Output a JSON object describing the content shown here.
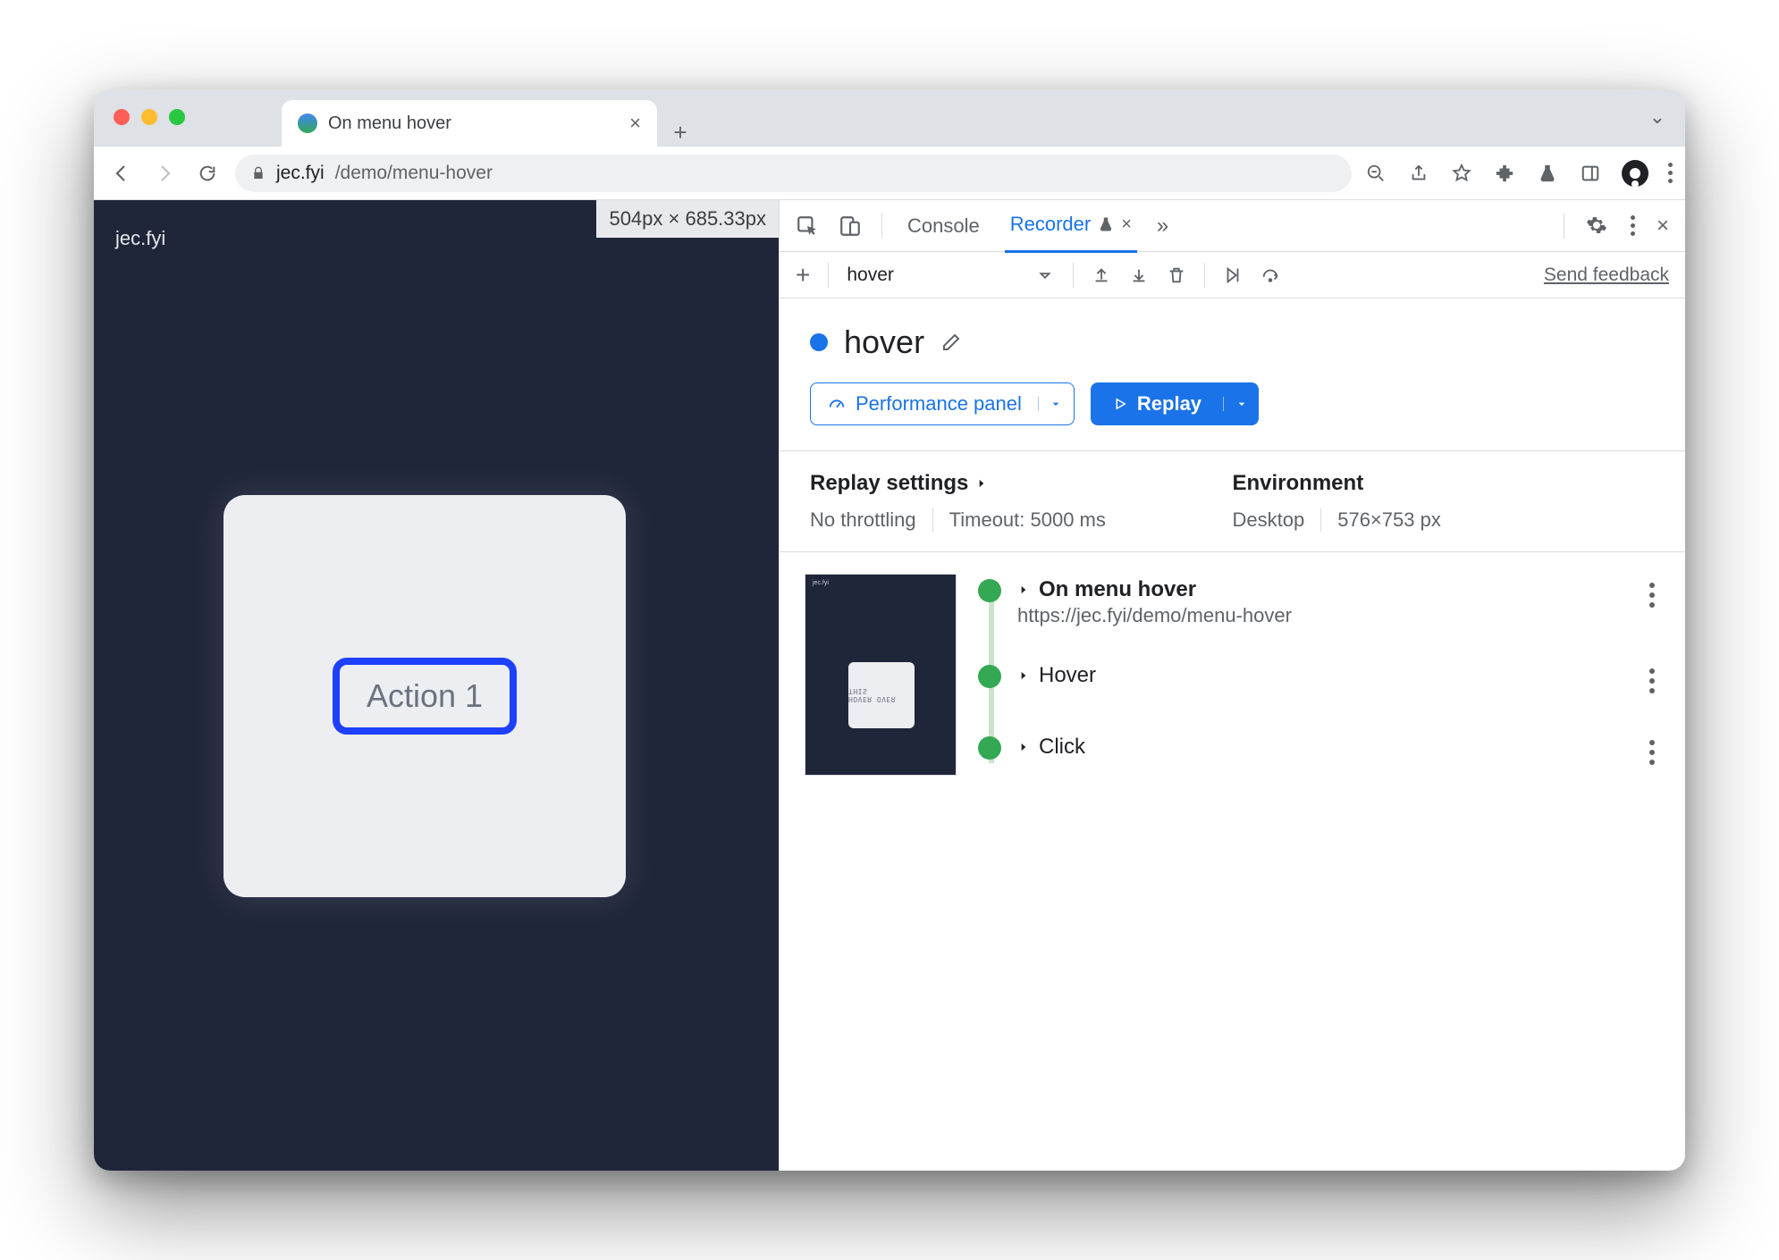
{
  "tab": {
    "title": "On menu hover"
  },
  "address": {
    "host": "jec.fyi",
    "path": "/demo/menu-hover"
  },
  "page": {
    "brand": "jec.fyi",
    "dimensions": "504px × 685.33px",
    "action_label": "Action 1"
  },
  "devtools": {
    "tabs": {
      "console": "Console",
      "recorder": "Recorder"
    },
    "toolbar": {
      "recording_select": "hover",
      "feedback": "Send feedback"
    },
    "recording": {
      "title": "hover",
      "perf_button": "Performance panel",
      "replay_button": "Replay"
    },
    "settings": {
      "replay_header": "Replay settings",
      "env_header": "Environment",
      "throttling": "No throttling",
      "timeout": "Timeout: 5000 ms",
      "device": "Desktop",
      "viewport": "576×753 px"
    },
    "steps": [
      {
        "title": "On menu hover",
        "sub": "https://jec.fyi/demo/menu-hover"
      },
      {
        "title": "Hover"
      },
      {
        "title": "Click"
      }
    ]
  }
}
